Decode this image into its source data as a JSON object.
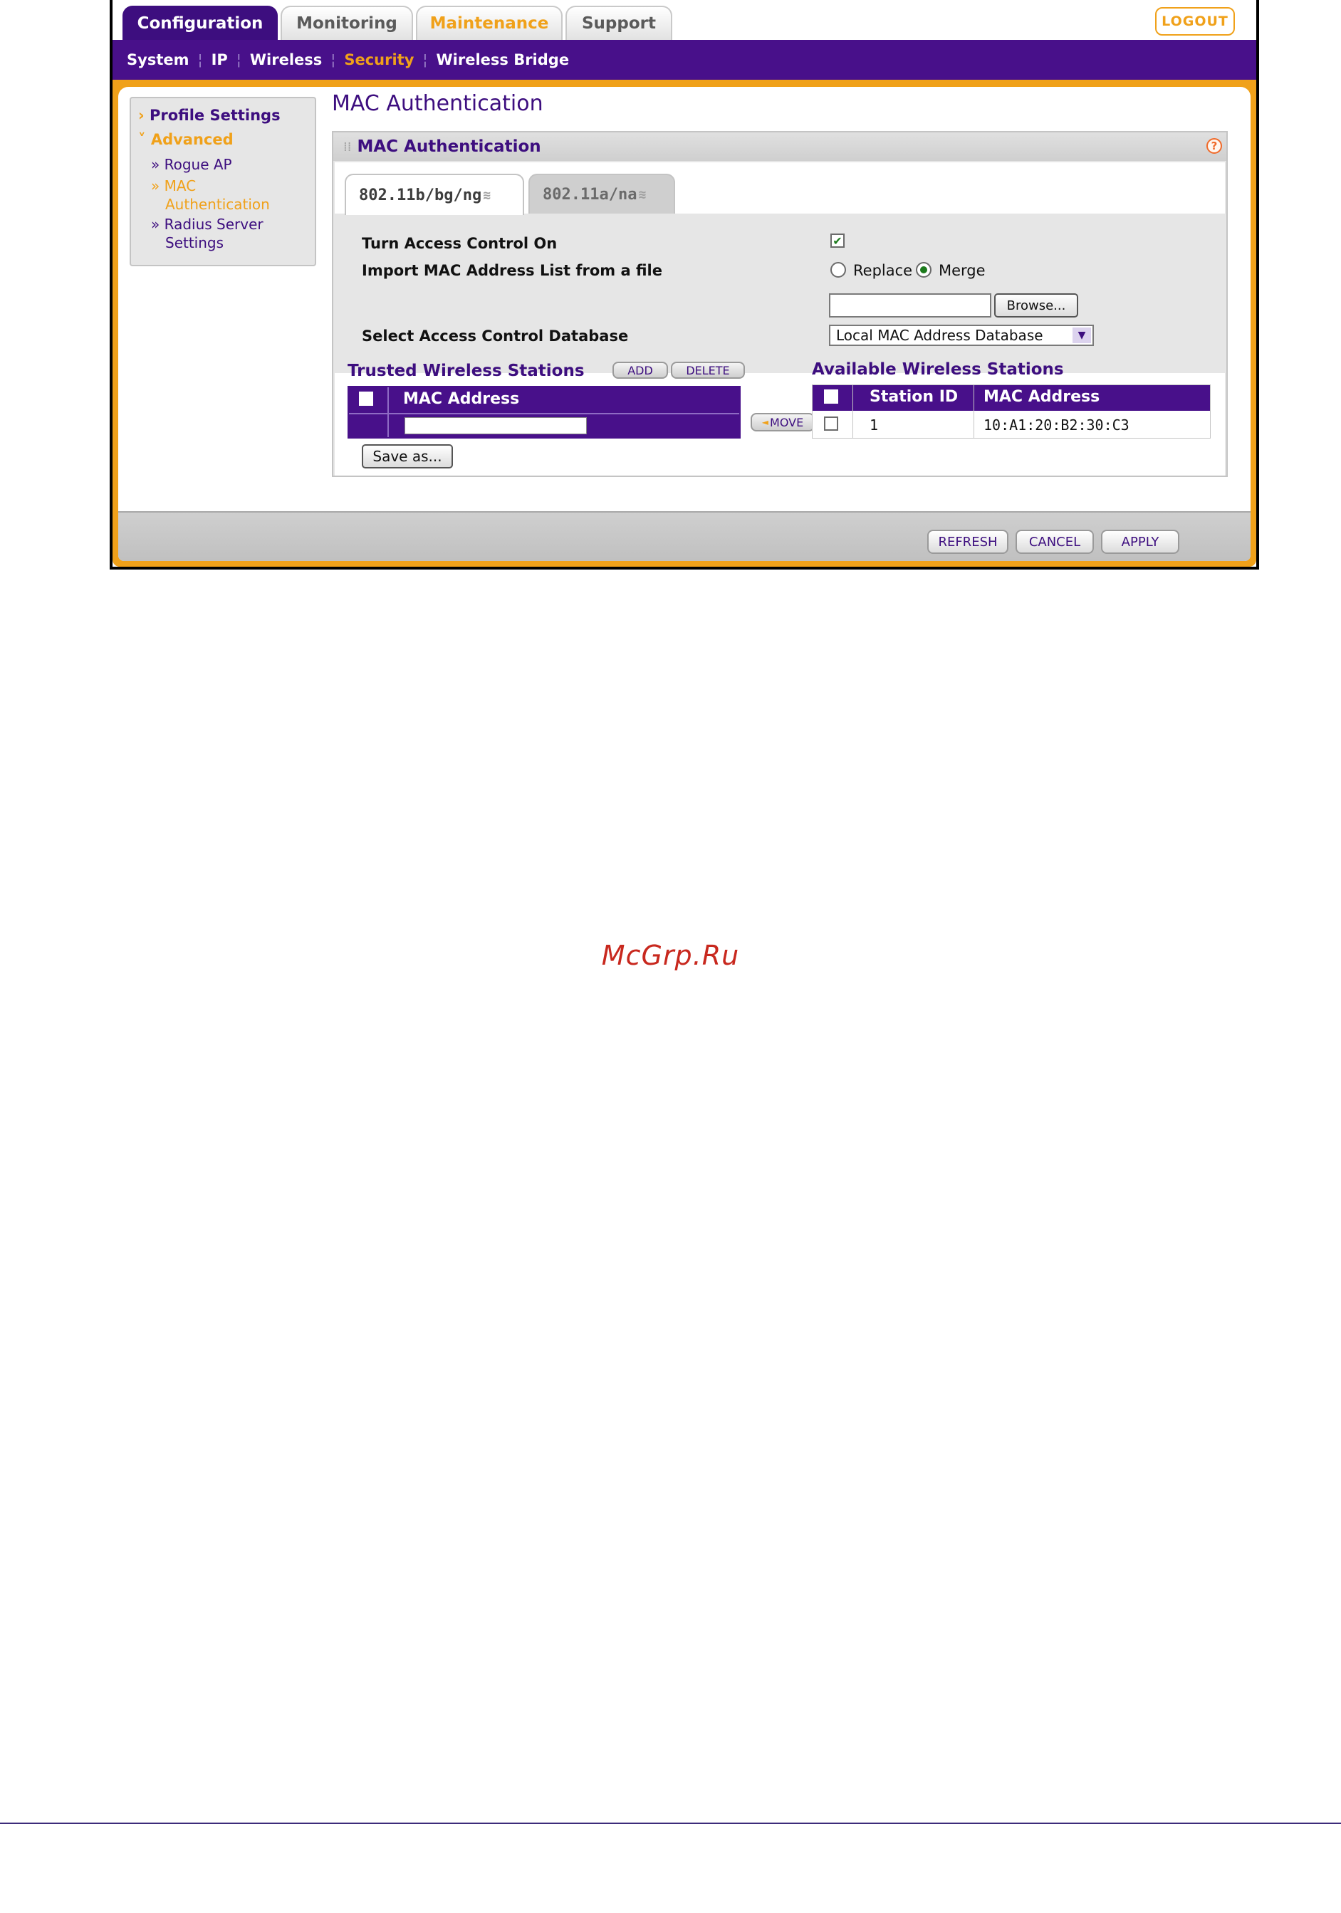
{
  "top_tabs": [
    "Configuration",
    "Monitoring",
    "Maintenance",
    "Support"
  ],
  "logout_label": "LOGOUT",
  "subnav": [
    "System",
    "IP",
    "Wireless",
    "Security",
    "Wireless Bridge"
  ],
  "sidebar": {
    "profile_settings": "Profile Settings",
    "advanced": "Advanced",
    "items": [
      "Rogue AP",
      "MAC",
      "Authentication",
      "Radius Server",
      "Settings"
    ]
  },
  "page_title": "MAC Authentication",
  "panel": {
    "title": "MAC Authentication",
    "help_icon": "help-icon",
    "radio_tabs": [
      "802.11b/bg/ng",
      "802.11a/na"
    ]
  },
  "form": {
    "access_control_label": "Turn Access Control On",
    "access_control_checked": true,
    "import_label": "Import MAC Address List from a file",
    "import_options": [
      "Replace",
      "Merge"
    ],
    "import_selected": "Merge",
    "file_value": "",
    "browse_label": "Browse...",
    "db_label": "Select Access Control Database",
    "db_selected": "Local MAC Address Database"
  },
  "trusted": {
    "title": "Trusted Wireless Stations",
    "add_label": "ADD",
    "delete_label": "DELETE",
    "column": "MAC Address",
    "input_value": ""
  },
  "move_label": "MOVE",
  "available": {
    "title": "Available Wireless Stations",
    "columns": [
      "Station ID",
      "MAC Address"
    ],
    "rows": [
      {
        "station_id": "1",
        "mac": "10:A1:20:B2:30:C3"
      }
    ]
  },
  "save_as_label": "Save as...",
  "bottom_buttons": [
    "REFRESH",
    "CANCEL",
    "APPLY"
  ],
  "watermark": "McGrp.Ru",
  "colors": {
    "purple": "#48108a",
    "orange": "#f0a11a",
    "dark_purple": "#3d0e7f"
  }
}
